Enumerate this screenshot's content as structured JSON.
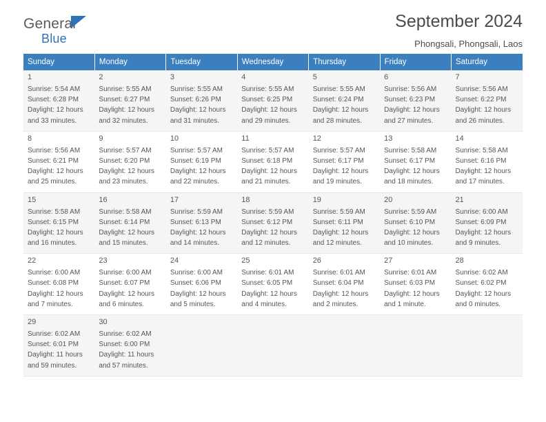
{
  "brand": {
    "name_line1": "General",
    "name_line2": "Blue",
    "accent_color": "#2e73b8",
    "flag_icon": "flag-triangle-icon"
  },
  "header": {
    "title": "September 2024",
    "location": "Phongsali, Phongsali, Laos"
  },
  "colors": {
    "header_row_bg": "#3c7fbf",
    "row_alt_bg": "#f5f5f5",
    "text": "#555555"
  },
  "weekdays": [
    "Sunday",
    "Monday",
    "Tuesday",
    "Wednesday",
    "Thursday",
    "Friday",
    "Saturday"
  ],
  "weeks": [
    [
      {
        "day": "1",
        "lines": [
          "Sunrise: 5:54 AM",
          "Sunset: 6:28 PM",
          "Daylight: 12 hours",
          "and 33 minutes."
        ]
      },
      {
        "day": "2",
        "lines": [
          "Sunrise: 5:55 AM",
          "Sunset: 6:27 PM",
          "Daylight: 12 hours",
          "and 32 minutes."
        ]
      },
      {
        "day": "3",
        "lines": [
          "Sunrise: 5:55 AM",
          "Sunset: 6:26 PM",
          "Daylight: 12 hours",
          "and 31 minutes."
        ]
      },
      {
        "day": "4",
        "lines": [
          "Sunrise: 5:55 AM",
          "Sunset: 6:25 PM",
          "Daylight: 12 hours",
          "and 29 minutes."
        ]
      },
      {
        "day": "5",
        "lines": [
          "Sunrise: 5:55 AM",
          "Sunset: 6:24 PM",
          "Daylight: 12 hours",
          "and 28 minutes."
        ]
      },
      {
        "day": "6",
        "lines": [
          "Sunrise: 5:56 AM",
          "Sunset: 6:23 PM",
          "Daylight: 12 hours",
          "and 27 minutes."
        ]
      },
      {
        "day": "7",
        "lines": [
          "Sunrise: 5:56 AM",
          "Sunset: 6:22 PM",
          "Daylight: 12 hours",
          "and 26 minutes."
        ]
      }
    ],
    [
      {
        "day": "8",
        "lines": [
          "Sunrise: 5:56 AM",
          "Sunset: 6:21 PM",
          "Daylight: 12 hours",
          "and 25 minutes."
        ]
      },
      {
        "day": "9",
        "lines": [
          "Sunrise: 5:57 AM",
          "Sunset: 6:20 PM",
          "Daylight: 12 hours",
          "and 23 minutes."
        ]
      },
      {
        "day": "10",
        "lines": [
          "Sunrise: 5:57 AM",
          "Sunset: 6:19 PM",
          "Daylight: 12 hours",
          "and 22 minutes."
        ]
      },
      {
        "day": "11",
        "lines": [
          "Sunrise: 5:57 AM",
          "Sunset: 6:18 PM",
          "Daylight: 12 hours",
          "and 21 minutes."
        ]
      },
      {
        "day": "12",
        "lines": [
          "Sunrise: 5:57 AM",
          "Sunset: 6:17 PM",
          "Daylight: 12 hours",
          "and 19 minutes."
        ]
      },
      {
        "day": "13",
        "lines": [
          "Sunrise: 5:58 AM",
          "Sunset: 6:17 PM",
          "Daylight: 12 hours",
          "and 18 minutes."
        ]
      },
      {
        "day": "14",
        "lines": [
          "Sunrise: 5:58 AM",
          "Sunset: 6:16 PM",
          "Daylight: 12 hours",
          "and 17 minutes."
        ]
      }
    ],
    [
      {
        "day": "15",
        "lines": [
          "Sunrise: 5:58 AM",
          "Sunset: 6:15 PM",
          "Daylight: 12 hours",
          "and 16 minutes."
        ]
      },
      {
        "day": "16",
        "lines": [
          "Sunrise: 5:58 AM",
          "Sunset: 6:14 PM",
          "Daylight: 12 hours",
          "and 15 minutes."
        ]
      },
      {
        "day": "17",
        "lines": [
          "Sunrise: 5:59 AM",
          "Sunset: 6:13 PM",
          "Daylight: 12 hours",
          "and 14 minutes."
        ]
      },
      {
        "day": "18",
        "lines": [
          "Sunrise: 5:59 AM",
          "Sunset: 6:12 PM",
          "Daylight: 12 hours",
          "and 12 minutes."
        ]
      },
      {
        "day": "19",
        "lines": [
          "Sunrise: 5:59 AM",
          "Sunset: 6:11 PM",
          "Daylight: 12 hours",
          "and 12 minutes."
        ]
      },
      {
        "day": "20",
        "lines": [
          "Sunrise: 5:59 AM",
          "Sunset: 6:10 PM",
          "Daylight: 12 hours",
          "and 10 minutes."
        ]
      },
      {
        "day": "21",
        "lines": [
          "Sunrise: 6:00 AM",
          "Sunset: 6:09 PM",
          "Daylight: 12 hours",
          "and 9 minutes."
        ]
      }
    ],
    [
      {
        "day": "22",
        "lines": [
          "Sunrise: 6:00 AM",
          "Sunset: 6:08 PM",
          "Daylight: 12 hours",
          "and 7 minutes."
        ]
      },
      {
        "day": "23",
        "lines": [
          "Sunrise: 6:00 AM",
          "Sunset: 6:07 PM",
          "Daylight: 12 hours",
          "and 6 minutes."
        ]
      },
      {
        "day": "24",
        "lines": [
          "Sunrise: 6:00 AM",
          "Sunset: 6:06 PM",
          "Daylight: 12 hours",
          "and 5 minutes."
        ]
      },
      {
        "day": "25",
        "lines": [
          "Sunrise: 6:01 AM",
          "Sunset: 6:05 PM",
          "Daylight: 12 hours",
          "and 4 minutes."
        ]
      },
      {
        "day": "26",
        "lines": [
          "Sunrise: 6:01 AM",
          "Sunset: 6:04 PM",
          "Daylight: 12 hours",
          "and 2 minutes."
        ]
      },
      {
        "day": "27",
        "lines": [
          "Sunrise: 6:01 AM",
          "Sunset: 6:03 PM",
          "Daylight: 12 hours",
          "and 1 minute."
        ]
      },
      {
        "day": "28",
        "lines": [
          "Sunrise: 6:02 AM",
          "Sunset: 6:02 PM",
          "Daylight: 12 hours",
          "and 0 minutes."
        ]
      }
    ],
    [
      {
        "day": "29",
        "lines": [
          "Sunrise: 6:02 AM",
          "Sunset: 6:01 PM",
          "Daylight: 11 hours",
          "and 59 minutes."
        ]
      },
      {
        "day": "30",
        "lines": [
          "Sunrise: 6:02 AM",
          "Sunset: 6:00 PM",
          "Daylight: 11 hours",
          "and 57 minutes."
        ]
      },
      {
        "day": "",
        "lines": []
      },
      {
        "day": "",
        "lines": []
      },
      {
        "day": "",
        "lines": []
      },
      {
        "day": "",
        "lines": []
      },
      {
        "day": "",
        "lines": []
      }
    ]
  ]
}
